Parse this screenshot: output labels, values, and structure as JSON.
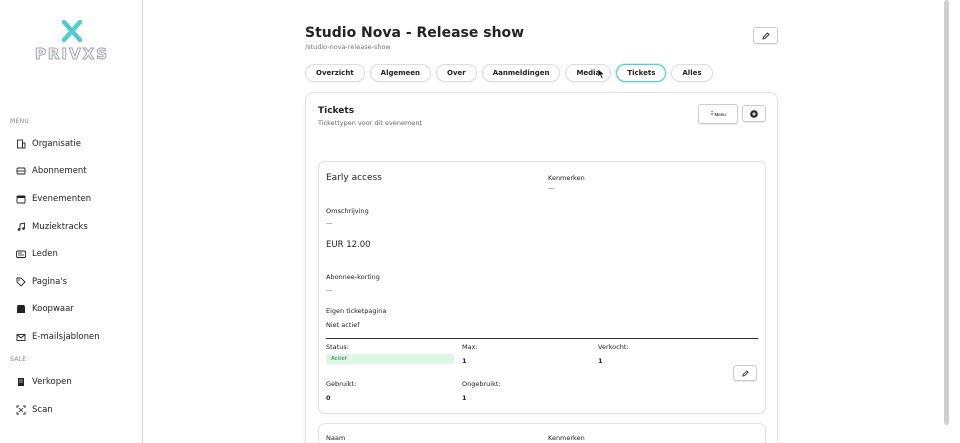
{
  "sidebar": {
    "logo_text": "PRIVXS",
    "sections": {
      "menu": "MENU",
      "sale": "SALE"
    },
    "items": [
      {
        "label": "Organisatie",
        "icon": "building-icon"
      },
      {
        "label": "Abonnement",
        "icon": "inbox-icon"
      },
      {
        "label": "Evenementen",
        "icon": "calendar-icon"
      },
      {
        "label": "Muziektracks",
        "icon": "music-icon"
      },
      {
        "label": "Leden",
        "icon": "id-card-icon"
      },
      {
        "label": "Pagina's",
        "icon": "tag-icon"
      },
      {
        "label": "Koopwaar",
        "icon": "box-icon"
      },
      {
        "label": "E-mailsjablonen",
        "icon": "mail-icon"
      }
    ],
    "sale_items": [
      {
        "label": "Verkopen",
        "icon": "receipt-icon"
      },
      {
        "label": "Scan",
        "icon": "scan-icon"
      }
    ]
  },
  "header": {
    "title": "Studio Nova - Release show",
    "slug": "/studio-nova-release-show"
  },
  "tabs": [
    {
      "label": "Overzicht",
      "active": false
    },
    {
      "label": "Algemeen",
      "active": false
    },
    {
      "label": "Over",
      "active": false
    },
    {
      "label": "Aanmeldingen",
      "active": false
    },
    {
      "label": "Media",
      "active": false
    },
    {
      "label": "Tickets",
      "active": true
    },
    {
      "label": "Alles",
      "active": false
    }
  ],
  "tickets": {
    "title": "Tickets",
    "subtitle": "Tickettypen voor dit evenement",
    "menu_label": "Menu",
    "ticket": {
      "name": "Early access",
      "features_label": "Kenmerken",
      "features_value": "—",
      "description_label": "Omschrijving",
      "description_value": "—",
      "price": "EUR 12.00",
      "discount_label": "Abonnee-korting",
      "discount_value": "—",
      "own_page_label": "Eigen ticketpagina",
      "own_page_value": "Niet actief",
      "status_label": "Status:",
      "status_value": "Actief",
      "max_label": "Max:",
      "max_value": "1",
      "sold_label": "Verkocht:",
      "sold_value": "1",
      "used_label": "Gebruikt:",
      "used_value": "0",
      "unused_label": "Ongebruikt:",
      "unused_value": "1"
    },
    "ticket2": {
      "name_label": "Naam",
      "features_label": "Kenmerken"
    }
  },
  "colors": {
    "accent": "#4fd1c5",
    "status_bg": "#dcf7e3",
    "status_text": "#2c7a4a"
  }
}
